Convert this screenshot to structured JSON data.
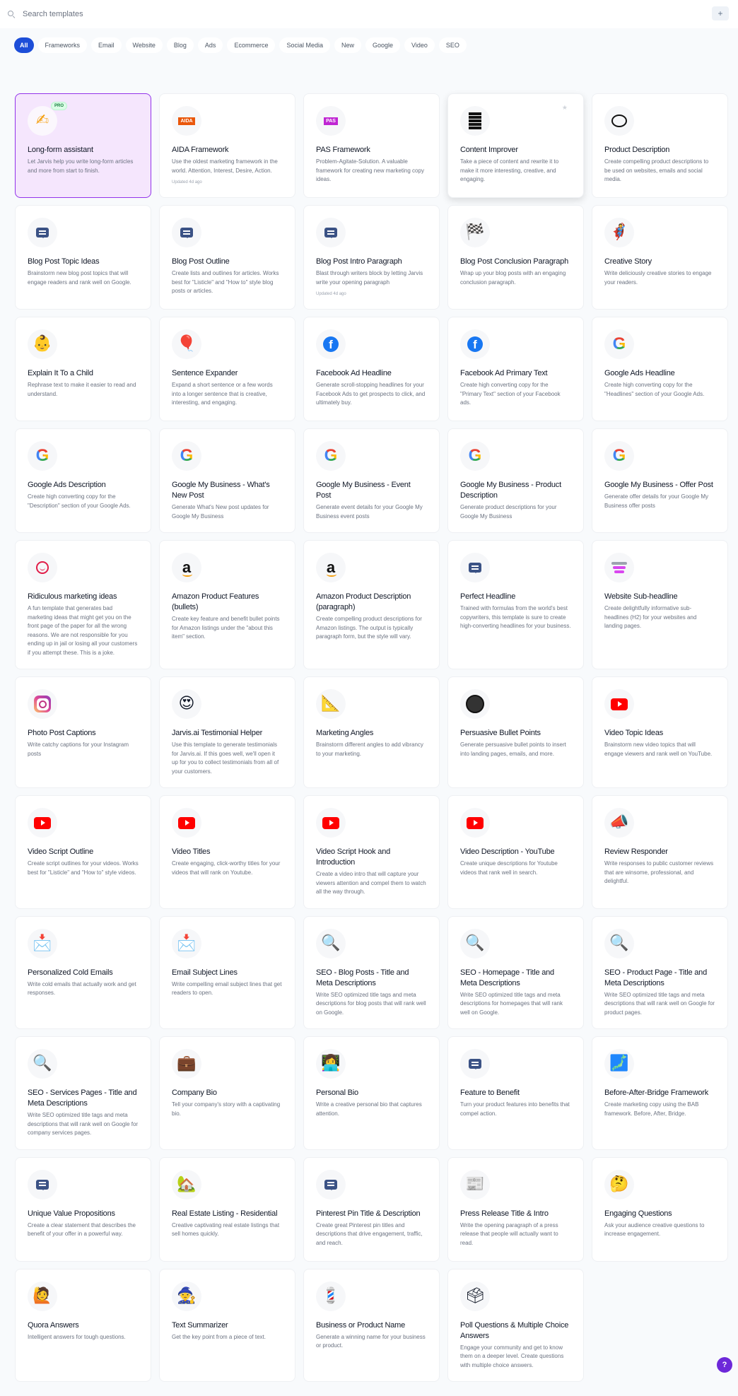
{
  "search": {
    "placeholder": "Search templates",
    "icon": "search-icon"
  },
  "add_button": {
    "icon": "plus-icon",
    "label": "+"
  },
  "filters": [
    {
      "label": "All",
      "active": true
    },
    {
      "label": "Frameworks"
    },
    {
      "label": "Email"
    },
    {
      "label": "Website"
    },
    {
      "label": "Blog"
    },
    {
      "label": "Ads"
    },
    {
      "label": "Ecommerce"
    },
    {
      "label": "Social Media"
    },
    {
      "label": "New"
    },
    {
      "label": "Google"
    },
    {
      "label": "Video"
    },
    {
      "label": "SEO"
    }
  ],
  "badges": {
    "pro": "PRO"
  },
  "help": {
    "label": "?"
  },
  "templates": [
    {
      "title": "Long-form assistant",
      "desc": "Let Jarvis help you write long-form articles and more from start to finish.",
      "icon": "writing-hand-icon",
      "glyph": "✍",
      "pro": true,
      "highlight": true
    },
    {
      "title": "AIDA Framework",
      "desc": "Use the oldest marketing framework in the world. Attention, Interest, Desire, Action.",
      "icon": "aida-icon",
      "glyph": "AIDA",
      "updated": "Updated 4d ago"
    },
    {
      "title": "PAS Framework",
      "desc": "Problem-Agitate-Solution. A valuable framework for creating new marketing copy ideas.",
      "icon": "pas-icon",
      "glyph": "PAS"
    },
    {
      "title": "Content Improver",
      "desc": "Take a piece of content and rewrite it to make it more interesting, creative, and engaging.",
      "icon": "text-lines-icon",
      "hovered": true,
      "star": "★"
    },
    {
      "title": "Product Description",
      "desc": "Create compelling product descriptions to be used on websites, emails and social media.",
      "icon": "thought-bubble-icon"
    },
    {
      "title": "Blog Post Topic Ideas",
      "desc": "Brainstorm new blog post topics that will engage readers and rank well on Google.",
      "icon": "chat-bubble-icon"
    },
    {
      "title": "Blog Post Outline",
      "desc": "Create lists and outlines for articles. Works best for \"Listicle\" and \"How to\" style blog posts or articles.",
      "icon": "chat-bubble-icon"
    },
    {
      "title": "Blog Post Intro Paragraph",
      "desc": "Blast through writers block by letting Jarvis write your opening paragraph",
      "icon": "chat-bubble-icon",
      "updated": "Updated 4d ago"
    },
    {
      "title": "Blog Post Conclusion Paragraph",
      "desc": "Wrap up your blog posts with an engaging conclusion paragraph.",
      "icon": "checkered-flag-icon",
      "glyph": "🏁"
    },
    {
      "title": "Creative Story",
      "desc": "Write deliciously creative stories to engage your readers.",
      "icon": "superhero-icon",
      "glyph": "🦸"
    },
    {
      "title": "Explain It To a Child",
      "desc": "Rephrase text to make it easier to read and understand.",
      "icon": "baby-icon",
      "glyph": "👶"
    },
    {
      "title": "Sentence Expander",
      "desc": "Expand a short sentence or a few words into a longer sentence that is creative, interesting, and engaging.",
      "icon": "balloon-icon",
      "glyph": "🎈"
    },
    {
      "title": "Facebook Ad Headline",
      "desc": "Generate scroll-stopping headlines for your Facebook Ads to get prospects to click, and ultimately buy.",
      "icon": "facebook-icon",
      "glyph": "f"
    },
    {
      "title": "Facebook Ad Primary Text",
      "desc": "Create high converting copy for the \"Primary Text\" section of your Facebook ads.",
      "icon": "facebook-icon",
      "glyph": "f"
    },
    {
      "title": "Google Ads Headline",
      "desc": "Create high converting copy for the \"Headlines\" section of your Google Ads.",
      "icon": "google-icon",
      "glyph": "G"
    },
    {
      "title": "Google Ads Description",
      "desc": "Create high converting copy for the \"Description\" section of your Google Ads.",
      "icon": "google-icon",
      "glyph": "G"
    },
    {
      "title": "Google My Business - What's New Post",
      "desc": "Generate What's New post updates for Google My Business",
      "icon": "google-icon",
      "glyph": "G"
    },
    {
      "title": "Google My Business - Event Post",
      "desc": "Generate event details for your Google My Business event posts",
      "icon": "google-icon",
      "glyph": "G"
    },
    {
      "title": "Google My Business - Product Description",
      "desc": "Generate product descriptions for your Google My Business",
      "icon": "google-icon",
      "glyph": "G"
    },
    {
      "title": "Google My Business - Offer Post",
      "desc": "Generate offer details for your Google My Business offer posts",
      "icon": "google-icon",
      "glyph": "G"
    },
    {
      "title": "Ridiculous marketing ideas",
      "desc": "A fun template that generates bad marketing ideas that might get you on the front page of the paper for all the wrong reasons. We are not responsible for you ending up in jail or losing all your customers if you attempt these. This is a joke.",
      "icon": "smiley-icon"
    },
    {
      "title": "Amazon Product Features (bullets)",
      "desc": "Create key feature and benefit bullet points for Amazon listings under the \"about this item\" section.",
      "icon": "amazon-icon",
      "glyph": "a"
    },
    {
      "title": "Amazon Product Description (paragraph)",
      "desc": "Create compelling product descriptions for Amazon listings. The output is typically paragraph form, but the style will vary.",
      "icon": "amazon-icon",
      "glyph": "a"
    },
    {
      "title": "Perfect Headline",
      "desc": "Trained with formulas from the world's best copywriters, this template is sure to create high-converting headlines for your business.",
      "icon": "chat-bubble-icon"
    },
    {
      "title": "Website Sub-headline",
      "desc": "Create delightfully informative sub-headlines (H2) for your websites and landing pages.",
      "icon": "subheadline-icon"
    },
    {
      "title": "Photo Post Captions",
      "desc": "Write catchy captions for your Instagram posts",
      "icon": "instagram-icon"
    },
    {
      "title": "Jarvis.ai Testimonial Helper",
      "desc": "Use this template to generate testimonials for Jarvis.ai. If this goes well, we'll open it up for you to collect testimonials from all of your customers.",
      "icon": "heart-eyes-icon",
      "glyph": "😍"
    },
    {
      "title": "Marketing Angles",
      "desc": "Brainstorm different angles to add vibrancy to your marketing.",
      "icon": "triangle-ruler-icon",
      "glyph": "📐"
    },
    {
      "title": "Persuasive Bullet Points",
      "desc": "Generate persuasive bullet points to insert into landing pages, emails, and more.",
      "icon": "black-circle-icon"
    },
    {
      "title": "Video Topic Ideas",
      "desc": "Brainstorm new video topics that will engage viewers and rank well on YouTube.",
      "icon": "youtube-icon"
    },
    {
      "title": "Video Script Outline",
      "desc": "Create script outlines for your videos. Works best for \"Listicle\" and \"How to\" style videos.",
      "icon": "youtube-icon"
    },
    {
      "title": "Video Titles",
      "desc": "Create engaging, click-worthy titles for your videos that will rank on Youtube.",
      "icon": "youtube-icon"
    },
    {
      "title": "Video Script Hook and Introduction",
      "desc": "Create a video intro that will capture your viewers attention and compel them to watch all the way through.",
      "icon": "youtube-icon"
    },
    {
      "title": "Video Description - YouTube",
      "desc": "Create unique descriptions for Youtube videos that rank well in search.",
      "icon": "youtube-icon"
    },
    {
      "title": "Review Responder",
      "desc": "Write responses to public customer reviews that are winsome, professional, and delightful.",
      "icon": "megaphone-icon",
      "glyph": "📣"
    },
    {
      "title": "Personalized Cold Emails",
      "desc": "Write cold emails that actually work and get responses.",
      "icon": "envelope-icon",
      "glyph": "📩"
    },
    {
      "title": "Email Subject Lines",
      "desc": "Write compelling email subject lines that get readers to open.",
      "icon": "envelope-icon",
      "glyph": "📩"
    },
    {
      "title": "SEO - Blog Posts - Title and Meta Descriptions",
      "desc": "Write SEO optimized title tags and meta descriptions for blog posts that will rank well on Google.",
      "icon": "magnifier-icon",
      "glyph": "🔍"
    },
    {
      "title": "SEO - Homepage - Title and Meta Descriptions",
      "desc": "Write SEO optimized title tags and meta descriptions for homepages that will rank well on Google.",
      "icon": "magnifier-icon",
      "glyph": "🔍"
    },
    {
      "title": "SEO - Product Page - Title and Meta Descriptions",
      "desc": "Write SEO optimized title tags and meta descriptions that will rank well on Google for product pages.",
      "icon": "magnifier-icon",
      "glyph": "🔍"
    },
    {
      "title": "SEO - Services Pages - Title and Meta Descriptions",
      "desc": "Write SEO optimized title tags and meta descriptions that will rank well on Google for company services pages.",
      "icon": "magnifier-icon",
      "glyph": "🔍"
    },
    {
      "title": "Company Bio",
      "desc": "Tell your company's story with a captivating bio.",
      "icon": "briefcase-icon",
      "glyph": "💼"
    },
    {
      "title": "Personal Bio",
      "desc": "Write a creative personal bio that captures attention.",
      "icon": "technologist-icon",
      "glyph": "👩‍💻"
    },
    {
      "title": "Feature to Benefit",
      "desc": "Turn your product features into benefits that compel action.",
      "icon": "chat-bubble-icon"
    },
    {
      "title": "Before-After-Bridge Framework",
      "desc": "Create marketing copy using the BAB framework. Before, After, Bridge.",
      "icon": "map-icon",
      "glyph": "🗾"
    },
    {
      "title": "Unique Value Propositions",
      "desc": "Create a clear statement that describes the benefit of your offer in a powerful way.",
      "icon": "chat-bubble-icon"
    },
    {
      "title": "Real Estate Listing - Residential",
      "desc": "Creative captivating real estate listings that sell homes quickly.",
      "icon": "house-icon",
      "glyph": "🏡"
    },
    {
      "title": "Pinterest Pin Title & Description",
      "desc": "Create great Pinterest pin titles and descriptions that drive engagement, traffic, and reach.",
      "icon": "chat-bubble-icon"
    },
    {
      "title": "Press Release Title & Intro",
      "desc": "Write the opening paragraph of a press release that people will actually want to read.",
      "icon": "newspaper-icon",
      "glyph": "📰"
    },
    {
      "title": "Engaging Questions",
      "desc": "Ask your audience creative questions to increase engagement.",
      "icon": "thinking-face-icon",
      "glyph": "🤔"
    },
    {
      "title": "Quora Answers",
      "desc": "Intelligent answers for tough questions.",
      "icon": "raising-hand-icon",
      "glyph": "🙋"
    },
    {
      "title": "Text Summarizer",
      "desc": "Get the key point from a piece of text.",
      "icon": "wizard-icon",
      "glyph": "🧙"
    },
    {
      "title": "Business or Product Name",
      "desc": "Generate a winning name for your business or product.",
      "icon": "barber-pole-icon",
      "glyph": "💈"
    },
    {
      "title": "Poll Questions & Multiple Choice Answers",
      "desc": "Engage your community and get to know them on a deeper level. Create questions with multiple choice answers.",
      "icon": "ballot-box-icon",
      "glyph": "🗳"
    }
  ]
}
